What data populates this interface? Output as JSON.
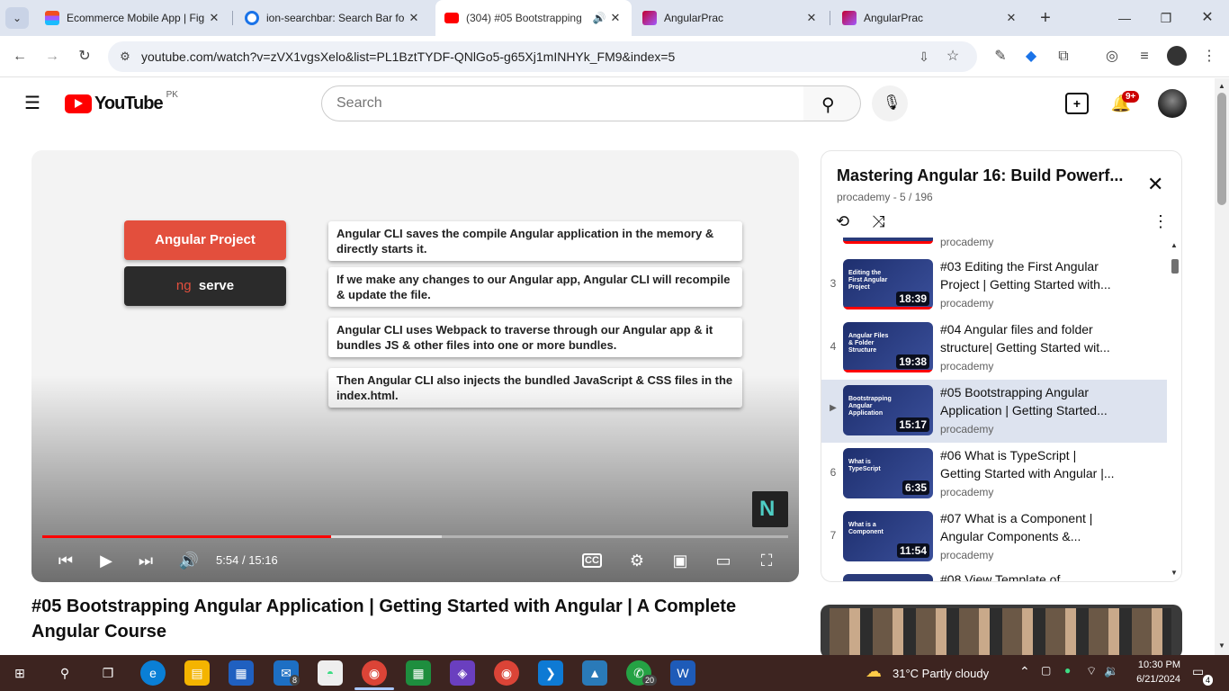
{
  "browser": {
    "tabs": [
      {
        "title": "Ecommerce Mobile App | Fig",
        "favicon": "figma-icon",
        "active": false
      },
      {
        "title": "ion-searchbar: Search Bar fo",
        "favicon": "chrome-icon",
        "active": false
      },
      {
        "title": "(304) #05 Bootstrapping",
        "favicon": "youtube-icon",
        "active": true
      },
      {
        "title": "AngularPrac",
        "favicon": "angular-icon",
        "active": false
      },
      {
        "title": "AngularPrac",
        "favicon": "angular-icon",
        "active": false
      }
    ],
    "url": "youtube.com/watch?v=zVX1vgsXelo&list=PL1BztTYDF-QNlGo5-g65Xj1mINHYk_FM9&index=5"
  },
  "youtube": {
    "logo_text": "YouTube",
    "region": "PK",
    "search_placeholder": "Search",
    "notif_count": "9+"
  },
  "player": {
    "slide": {
      "project_label": "Angular Project",
      "cmd_ng": "ng",
      "cmd_serve": "serve",
      "points": [
        "Angular CLI saves the compile Angular application in the memory & directly starts it.",
        "If we make any changes to our Angular app, Angular CLI will recompile & update the file.",
        "Angular CLI uses Webpack to traverse through our Angular app & it bundles JS & other files into one or more bundles.",
        "Then Angular CLI also injects the bundled JavaScript & CSS files in the index.html."
      ]
    },
    "time_current": "5:54",
    "time_separator": "/",
    "time_total": "15:16",
    "played_fraction": 0.387,
    "buffered_fraction": 0.535
  },
  "video_title": "#05 Bootstrapping Angular Application | Getting Started with Angular | A Complete Angular Course",
  "playlist": {
    "title": "Mastering Angular 16: Build Powerf...",
    "subtitle": "procademy - 5 / 196",
    "partial_top_channel": "procademy",
    "items": [
      {
        "index": "3",
        "title": "#03 Editing the First Angular Project | Getting Started with...",
        "channel": "procademy",
        "duration": "18:39",
        "thumb_text": "Editing the First Angular Project",
        "watched": true
      },
      {
        "index": "4",
        "title": "#04 Angular files and folder structure| Getting Started wit...",
        "channel": "procademy",
        "duration": "19:38",
        "thumb_text": "Angular Files & Folder Structure",
        "watched": true
      },
      {
        "index": "▶",
        "title": "#05 Bootstrapping Angular Application | Getting Started...",
        "channel": "procademy",
        "duration": "15:17",
        "thumb_text": "Bootstrapping Angular Application",
        "watched": false
      },
      {
        "index": "6",
        "title": "#06 What is TypeScript | Getting Started with Angular |...",
        "channel": "procademy",
        "duration": "6:35",
        "thumb_text": "What is TypeScript",
        "watched": false
      },
      {
        "index": "7",
        "title": "#07 What is a Component | Angular Components &...",
        "channel": "procademy",
        "duration": "11:54",
        "thumb_text": "What is a Component",
        "watched": false
      }
    ],
    "partial_bottom_title": "#08 View Template of..."
  },
  "taskbar": {
    "weather": "31°C  Partly cloudy",
    "time": "10:30 PM",
    "date": "6/21/2024",
    "notif_count": "4",
    "badge_mail": "8",
    "badge_whatsapp": "20"
  }
}
